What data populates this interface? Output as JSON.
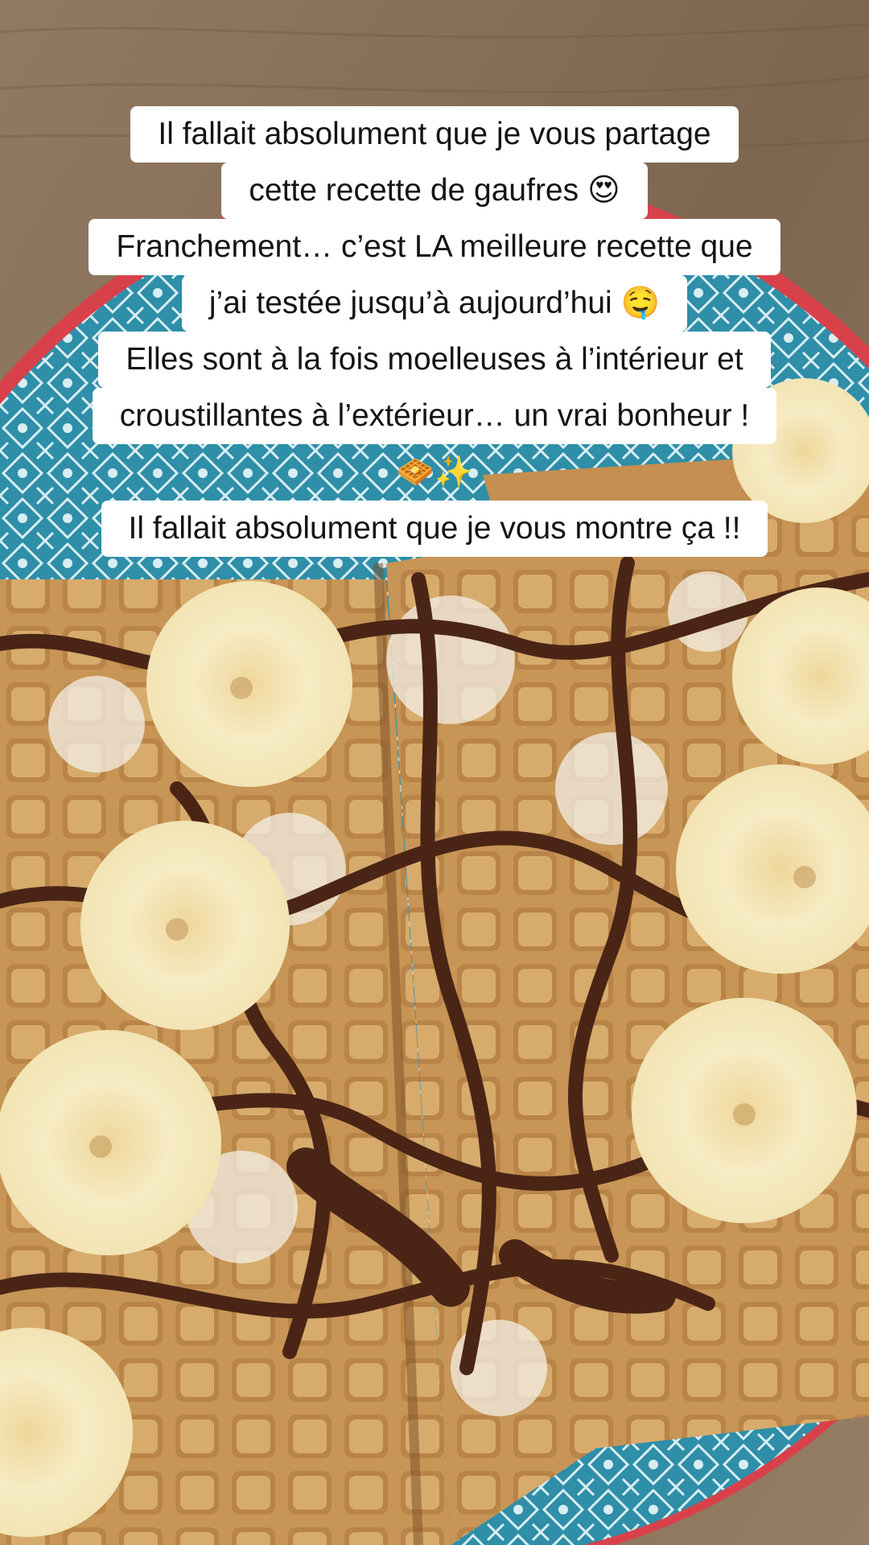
{
  "caption": {
    "lines": [
      "Il fallait absolument que je vous partage",
      "cette recette de gaufres 😍",
      "Franchement… c’est LA meilleure recette que",
      "j’ai testée jusqu’à aujourd’hui 🤤",
      "Elles sont à la fois moelleuses à l’intérieur et",
      "croustillantes à l’extérieur… un vrai bonheur !",
      "🧇✨",
      "Il fallait absolument que je vous montre ça !!"
    ]
  },
  "photo": {
    "subject": "waffles-with-banana-and-chocolate",
    "colors": {
      "table": "#8a6f55",
      "plate_rim": "#d9414a",
      "plate_pattern": "#2f8ea8",
      "waffle": "#c99a5a",
      "chocolate": "#4a2516",
      "banana": "#f3e4b2",
      "sugar": "#f2ede3"
    }
  }
}
